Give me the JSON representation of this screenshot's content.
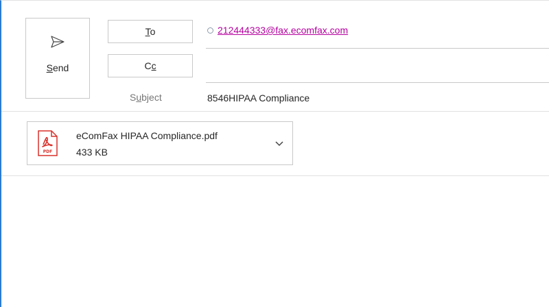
{
  "compose": {
    "send_label_underlined": "S",
    "send_label_rest": "end",
    "to_label_underlined": "T",
    "to_label_rest": "o",
    "cc_label_first": "C",
    "cc_label_underlined": "c",
    "subject_label_first": "S",
    "subject_label_underlined": "u",
    "subject_label_rest": "bject",
    "to_recipients": [
      {
        "address": "212444333@fax.ecomfax.com"
      }
    ],
    "subject_value": "8546HIPAA Compliance"
  },
  "attachment": {
    "name": "eComFax HIPAA Compliance.pdf",
    "size": "433 KB",
    "icon": "pdf-icon",
    "icon_text": "PDF"
  },
  "colors": {
    "accent": "#2b7cd3",
    "recipient_link": "#b4009e",
    "pdf_red": "#d9312b",
    "border": "#c8c8c8"
  }
}
